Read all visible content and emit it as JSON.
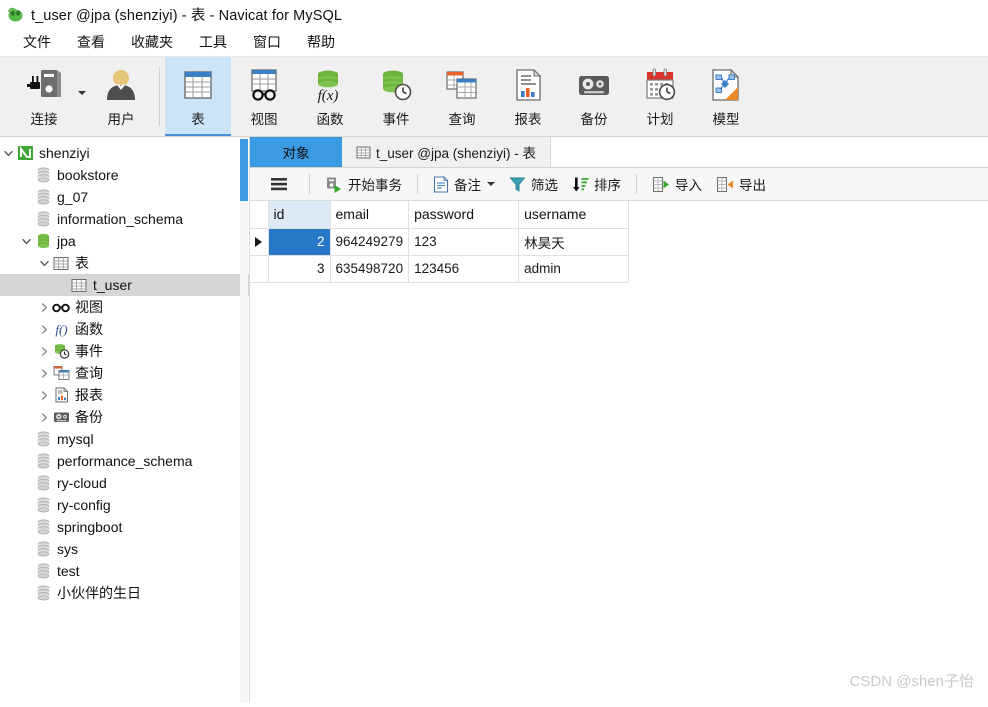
{
  "window": {
    "title": "t_user @jpa (shenziyi) - 表 - Navicat for MySQL",
    "logo_icon": "navicat-logo-icon"
  },
  "menubar": {
    "items": [
      {
        "label": "文件",
        "name": "menu-file"
      },
      {
        "label": "查看",
        "name": "menu-view"
      },
      {
        "label": "收藏夹",
        "name": "menu-favorites"
      },
      {
        "label": "工具",
        "name": "menu-tools"
      },
      {
        "label": "窗口",
        "name": "menu-window"
      },
      {
        "label": "帮助",
        "name": "menu-help"
      }
    ]
  },
  "toolbar": {
    "groups": [
      {
        "buttons": [
          {
            "label": "连接",
            "icon": "connection-icon",
            "has_caret": true,
            "active": false
          },
          {
            "label": "用户",
            "icon": "user-icon",
            "has_caret": false,
            "active": false
          }
        ]
      },
      {
        "buttons": [
          {
            "label": "表",
            "icon": "table-icon",
            "has_caret": false,
            "active": true
          },
          {
            "label": "视图",
            "icon": "view-glasses-icon",
            "has_caret": false,
            "active": false
          },
          {
            "label": "函数",
            "icon": "function-icon",
            "has_caret": false,
            "active": false
          },
          {
            "label": "事件",
            "icon": "event-clock-icon",
            "has_caret": false,
            "active": false
          },
          {
            "label": "查询",
            "icon": "query-icon",
            "has_caret": false,
            "active": false
          },
          {
            "label": "报表",
            "icon": "report-chart-icon",
            "has_caret": false,
            "active": false
          },
          {
            "label": "备份",
            "icon": "backup-tape-icon",
            "has_caret": false,
            "active": false
          },
          {
            "label": "计划",
            "icon": "schedule-calendar-icon",
            "has_caret": false,
            "active": false
          },
          {
            "label": "模型",
            "icon": "model-diagram-icon",
            "has_caret": false,
            "active": false
          }
        ]
      }
    ]
  },
  "sidebar": {
    "items": [
      {
        "label": "shenziyi",
        "icon": "connection-green-icon",
        "indent": 0,
        "twisty": "expanded",
        "selected": false
      },
      {
        "label": "bookstore",
        "icon": "database-gray-icon",
        "indent": 1,
        "twisty": "none",
        "selected": false
      },
      {
        "label": "g_07",
        "icon": "database-gray-icon",
        "indent": 1,
        "twisty": "none",
        "selected": false
      },
      {
        "label": "information_schema",
        "icon": "database-gray-icon",
        "indent": 1,
        "twisty": "none",
        "selected": false
      },
      {
        "label": "jpa",
        "icon": "database-green-icon",
        "indent": 1,
        "twisty": "expanded",
        "selected": false
      },
      {
        "label": "表",
        "icon": "table-icon",
        "indent": 2,
        "twisty": "expanded",
        "selected": false
      },
      {
        "label": "t_user",
        "icon": "table-icon",
        "indent": 3,
        "twisty": "none",
        "selected": true
      },
      {
        "label": "视图",
        "icon": "view-glasses-icon",
        "indent": 2,
        "twisty": "collapsed",
        "selected": false
      },
      {
        "label": "函数",
        "icon": "function-icon",
        "indent": 2,
        "twisty": "collapsed",
        "selected": false
      },
      {
        "label": "事件",
        "icon": "event-clock-icon",
        "indent": 2,
        "twisty": "collapsed",
        "selected": false
      },
      {
        "label": "查询",
        "icon": "query-icon",
        "indent": 2,
        "twisty": "collapsed",
        "selected": false
      },
      {
        "label": "报表",
        "icon": "report-chart-icon",
        "indent": 2,
        "twisty": "collapsed",
        "selected": false
      },
      {
        "label": "备份",
        "icon": "backup-tape-icon",
        "indent": 2,
        "twisty": "collapsed",
        "selected": false
      },
      {
        "label": "mysql",
        "icon": "database-gray-icon",
        "indent": 1,
        "twisty": "none",
        "selected": false
      },
      {
        "label": "performance_schema",
        "icon": "database-gray-icon",
        "indent": 1,
        "twisty": "none",
        "selected": false
      },
      {
        "label": "ry-cloud",
        "icon": "database-gray-icon",
        "indent": 1,
        "twisty": "none",
        "selected": false
      },
      {
        "label": "ry-config",
        "icon": "database-gray-icon",
        "indent": 1,
        "twisty": "none",
        "selected": false
      },
      {
        "label": "springboot",
        "icon": "database-gray-icon",
        "indent": 1,
        "twisty": "none",
        "selected": false
      },
      {
        "label": "sys",
        "icon": "database-gray-icon",
        "indent": 1,
        "twisty": "none",
        "selected": false
      },
      {
        "label": "test",
        "icon": "database-gray-icon",
        "indent": 1,
        "twisty": "none",
        "selected": false
      },
      {
        "label": "小伙伴的生日",
        "icon": "database-gray-icon",
        "indent": 1,
        "twisty": "none",
        "selected": false
      }
    ]
  },
  "tabs": [
    {
      "label": "对象",
      "name": "tab-objects",
      "icon": "none",
      "active": true
    },
    {
      "label": "t_user @jpa (shenziyi) - 表",
      "name": "tab-t-user",
      "icon": "table-icon",
      "active": false
    }
  ],
  "actionbar": {
    "buttons": [
      {
        "label": "",
        "icon": "hamburger-menu-icon",
        "name": "grid-menu-button",
        "caret": false
      },
      {
        "label": "开始事务",
        "icon": "begin-transaction-icon",
        "name": "begin-transaction-button",
        "caret": false
      },
      {
        "label": "备注",
        "icon": "note-icon",
        "name": "note-button",
        "caret": true
      },
      {
        "label": "筛选",
        "icon": "filter-funnel-icon",
        "name": "filter-button",
        "caret": false
      },
      {
        "label": "排序",
        "icon": "sort-icon",
        "name": "sort-button",
        "caret": false
      },
      {
        "label": "导入",
        "icon": "import-icon",
        "name": "import-button",
        "caret": false
      },
      {
        "label": "导出",
        "icon": "export-icon",
        "name": "export-button",
        "caret": false
      }
    ]
  },
  "grid": {
    "columns": [
      {
        "label": "id",
        "key": "id",
        "class": "col-id",
        "align": "right",
        "header_highlight": true
      },
      {
        "label": "email",
        "key": "email",
        "class": "col-email",
        "align": "left",
        "header_highlight": false
      },
      {
        "label": "password",
        "key": "password",
        "class": "col-password",
        "align": "left",
        "header_highlight": false
      },
      {
        "label": "username",
        "key": "username",
        "class": "col-username",
        "align": "left",
        "header_highlight": false
      }
    ],
    "rows": [
      {
        "id": "2",
        "email": "964249279",
        "password": "123",
        "username": "林昊天",
        "current": true
      },
      {
        "id": "3",
        "email": "635498720",
        "password": "123456",
        "username": "admin",
        "current": false
      }
    ]
  },
  "watermark": {
    "text": "CSDN @shen子怡"
  },
  "colors": {
    "accent_blue": "#3b9ae1",
    "selection_blue": "#2878c8",
    "toolbar_active": "#cce4f7",
    "header_blue": "#ddeaf6",
    "tree_selected": "#d6d6d6",
    "chrome_gray": "#f0f0f0"
  }
}
